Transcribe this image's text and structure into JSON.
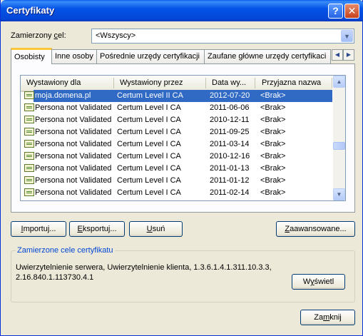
{
  "window": {
    "title": "Certyfikaty"
  },
  "intended_purpose": {
    "label_prefix": "Zamierzony ",
    "label_hotkey": "c",
    "label_suffix": "el:",
    "value": "<Wszyscy>"
  },
  "tabs": [
    {
      "label": "Osobisty"
    },
    {
      "label": "Inne osoby"
    },
    {
      "label": "Pośrednie urzędy certyfikacji"
    },
    {
      "label": "Zaufane główne urzędy certyfikaci"
    }
  ],
  "columns": {
    "issued_to": "Wystawiony dla",
    "issued_by": "Wystawiony przez",
    "expiry": "Data wy...",
    "friendly": "Przyjazna nazwa"
  },
  "certs": [
    {
      "to": "moja.domena.pl",
      "by": "Certum Level II CA",
      "date": "2012-07-20",
      "name": "<Brak>"
    },
    {
      "to": "Persona not Validated",
      "by": "Certum Level I CA",
      "date": "2011-06-06",
      "name": "<Brak>"
    },
    {
      "to": "Persona not Validated",
      "by": "Certum Level I CA",
      "date": "2010-12-11",
      "name": "<Brak>"
    },
    {
      "to": "Persona not Validated",
      "by": "Certum Level I CA",
      "date": "2011-09-25",
      "name": "<Brak>"
    },
    {
      "to": "Persona not Validated",
      "by": "Certum Level I CA",
      "date": "2011-03-14",
      "name": "<Brak>"
    },
    {
      "to": "Persona not Validated",
      "by": "Certum Level I CA",
      "date": "2010-12-16",
      "name": "<Brak>"
    },
    {
      "to": "Persona not Validated",
      "by": "Certum Level I CA",
      "date": "2011-01-13",
      "name": "<Brak>"
    },
    {
      "to": "Persona not Validated",
      "by": "Certum Level I CA",
      "date": "2011-01-12",
      "name": "<Brak>"
    },
    {
      "to": "Persona not Validated",
      "by": "Certum Level I CA",
      "date": "2011-02-14",
      "name": "<Brak>"
    }
  ],
  "buttons": {
    "import": {
      "hot": "I",
      "rest": "mportuj..."
    },
    "export": {
      "hot": "E",
      "rest": "ksportuj..."
    },
    "remove": {
      "hot": "U",
      "rest": "suń"
    },
    "advanced": {
      "hot": "Z",
      "rest": "aawansowane..."
    },
    "view": {
      "pre": "W",
      "hot": "y",
      "rest": "świetl"
    },
    "close": {
      "pre": "Za",
      "hot": "m",
      "rest": "knij"
    }
  },
  "purposes": {
    "title": "Zamierzone cele certyfikatu",
    "text": "Uwierzytelnienie serwera, Uwierzytelnienie klienta, 1.3.6.1.4.1.311.10.3.3, 2.16.840.1.113730.4.1"
  },
  "colors": {
    "titlebar": "#0553e7",
    "selection": "#316ac5",
    "tab_highlight": "#ffc83c",
    "group_title": "#0046d5"
  }
}
